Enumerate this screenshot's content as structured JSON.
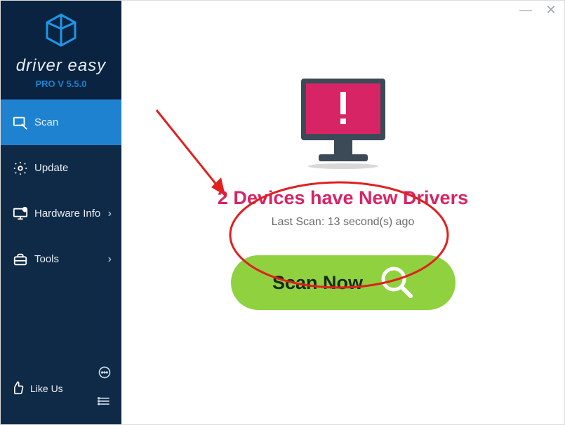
{
  "brand": {
    "name_part1": "driver",
    "name_part2": "easy",
    "version": "PRO V 5.5.0"
  },
  "sidebar": {
    "items": [
      {
        "label": "Scan",
        "id": "scan",
        "active": true,
        "expandable": false
      },
      {
        "label": "Update",
        "id": "update",
        "active": false,
        "expandable": false
      },
      {
        "label": "Hardware Info",
        "id": "hardware-info",
        "active": false,
        "expandable": true
      },
      {
        "label": "Tools",
        "id": "tools",
        "active": false,
        "expandable": true
      }
    ],
    "footer": {
      "like_label": "Like Us"
    }
  },
  "main": {
    "headline": "2 Devices have New Drivers",
    "last_scan_label": "Last Scan: 13 second(s) ago",
    "scan_button_label": "Scan Now"
  },
  "colors": {
    "sidebar_bg": "#0f2a47",
    "sidebar_active": "#1E82D1",
    "accent_pink": "#D72464",
    "scan_green": "#8FD13F",
    "annotation_red": "#E02020"
  }
}
